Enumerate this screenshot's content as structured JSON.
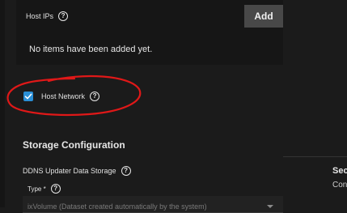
{
  "host_ips": {
    "label": "Host IPs",
    "help_icon": "question-circle-icon",
    "add_label": "Add",
    "empty_text": "No items have been added yet."
  },
  "host_network": {
    "label": "Host Network",
    "checked": true,
    "help_icon": "question-circle-icon"
  },
  "storage": {
    "title": "Storage Configuration",
    "ddns_label": "DDNS Updater Data Storage",
    "type_label": "Type *",
    "type_value": "ixVolume (Dataset created automatically by the system)"
  },
  "right_panel": {
    "title": "Sec",
    "subtitle": "Con"
  },
  "colors": {
    "background": "#1b1b1b",
    "card": "#161616",
    "checkbox": "#2a8fd6",
    "annotation": "#e01818",
    "button": "#484848"
  }
}
